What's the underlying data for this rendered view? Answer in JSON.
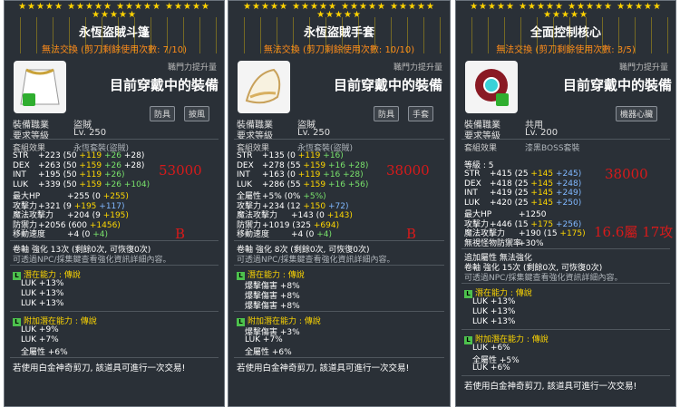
{
  "panels": [
    {
      "stars": "★★★★★ ★★★★★ ★★★★★ ★★★★★ ★★★★★",
      "title": "永恆盜賊斗篷",
      "trade": "無法交換 (剪刀剩餘使用次數: 7/10)",
      "job_boost": "職門力提升量",
      "equipped": "目前穿戴中的裝備",
      "tags": [
        "防具",
        "披風"
      ],
      "req_job_label": "裝備職業",
      "req_job": "盜賊",
      "req_level_label": "要求等級",
      "req_level": "Lv. 250",
      "set_label": "套組效果",
      "set_name": "永恆套裝(盜賊)",
      "stats": [
        {
          "name": "STR",
          "parts": [
            [
              "+223 (50 ",
              ""
            ],
            [
              "+119",
              "y"
            ],
            [
              " +26",
              "g"
            ],
            [
              " +28)",
              ""
            ]
          ]
        },
        {
          "name": "DEX",
          "parts": [
            [
              "+263 (50 ",
              ""
            ],
            [
              "+159",
              "y"
            ],
            [
              " +26",
              "g"
            ],
            [
              " +28)",
              ""
            ]
          ]
        },
        {
          "name": "INT",
          "parts": [
            [
              "+195 (50 ",
              ""
            ],
            [
              "+119",
              "y"
            ],
            [
              " +26)",
              "g"
            ]
          ]
        },
        {
          "name": "LUK",
          "parts": [
            [
              "+339 (50 ",
              ""
            ],
            [
              "+159",
              "y"
            ],
            [
              " +26",
              "g"
            ],
            [
              " +104)",
              "g"
            ]
          ]
        },
        {
          "name": "最大HP",
          "parts": [
            [
              "+255 (0 ",
              ""
            ],
            [
              "+255)",
              "y"
            ]
          ]
        },
        {
          "name": "攻擊力",
          "parts": [
            [
              "+321 (9 ",
              ""
            ],
            [
              "+195",
              "y"
            ],
            [
              " +117)",
              "b"
            ]
          ]
        },
        {
          "name": "魔法攻擊力",
          "parts": [
            [
              "+204 (9 ",
              ""
            ],
            [
              "+195)",
              "y"
            ]
          ]
        },
        {
          "name": "防禦力",
          "parts": [
            [
              "+2056 (600 ",
              ""
            ],
            [
              "+1456)",
              "y"
            ]
          ]
        },
        {
          "name": "移動速度",
          "parts": [
            [
              "+4 (0 ",
              ""
            ],
            [
              "+4)",
              "g"
            ]
          ]
        }
      ],
      "annot_value": "53000",
      "annot_grade": "B",
      "scroll_line": "卷軸 強化 13次 (剩餘0次, 可恢復0次)",
      "hint": "可透過NPC/採集鍵查看強化資訊詳細內容。",
      "potential_label": "潛在能力 : 傳說",
      "potential": [
        "LUK +13%",
        "LUK +13%",
        "LUK +13%"
      ],
      "add_potential_label": "附加潛在能力 : 傳說",
      "add_potential": [
        "LUK +9%",
        "LUK +7%",
        "全屬性 +6%"
      ],
      "footer": "若使用白金神奇剪刀, 該道具可進行一次交易!"
    },
    {
      "stars": "★★★★★ ★★★★★ ★★★★★ ★★★★★ ★★★★★",
      "title": "永恆盜賊手套",
      "trade": "無法交換 (剪刀剩餘使用次數: 10/10)",
      "job_boost": "職門力提升量",
      "equipped": "目前穿戴中的裝備",
      "tags": [
        "防具",
        "手套"
      ],
      "req_job_label": "裝備職業",
      "req_job": "盜賊",
      "req_level_label": "要求等級",
      "req_level": "Lv. 250",
      "set_label": "套組效果",
      "set_name": "永恆套裝(盜賊)",
      "stats": [
        {
          "name": "STR",
          "parts": [
            [
              "+135 (0 ",
              ""
            ],
            [
              "+119",
              "y"
            ],
            [
              " +16)",
              "g"
            ]
          ]
        },
        {
          "name": "DEX",
          "parts": [
            [
              "+278 (55 ",
              ""
            ],
            [
              "+159",
              "y"
            ],
            [
              " +16",
              "g"
            ],
            [
              " +28)",
              "g"
            ]
          ]
        },
        {
          "name": "INT",
          "parts": [
            [
              "+163 (0 ",
              ""
            ],
            [
              "+119",
              "y"
            ],
            [
              " +16",
              "g"
            ],
            [
              " +28)",
              "g"
            ]
          ]
        },
        {
          "name": "LUK",
          "parts": [
            [
              "+286 (55 ",
              ""
            ],
            [
              "+159",
              "y"
            ],
            [
              " +16",
              "g"
            ],
            [
              " +56)",
              "g"
            ]
          ]
        },
        {
          "name": "全屬性",
          "parts": [
            [
              "+5% (0% ",
              ""
            ],
            [
              "+5%)",
              "g"
            ]
          ]
        },
        {
          "name": "攻擊力",
          "parts": [
            [
              "+234 (12 ",
              ""
            ],
            [
              "+150",
              "y"
            ],
            [
              " +72)",
              "b"
            ]
          ]
        },
        {
          "name": "魔法攻擊力",
          "parts": [
            [
              "+143 (0 ",
              ""
            ],
            [
              "+143)",
              "y"
            ]
          ]
        },
        {
          "name": "防禦力",
          "parts": [
            [
              "+1019 (325 ",
              ""
            ],
            [
              "+694)",
              "y"
            ]
          ]
        },
        {
          "name": "移動速度",
          "parts": [
            [
              "+4 (0 ",
              ""
            ],
            [
              "+4)",
              "g"
            ]
          ]
        }
      ],
      "annot_value": "38000",
      "annot_grade": "B",
      "scroll_line": "卷軸 強化 8次 (剩餘0次, 可恢復0次)",
      "hint": "可透過NPC/採集鍵查看強化資訊詳細內容。",
      "potential_label": "潛在能力 : 傳說",
      "potential": [
        "爆擊傷害 +8%",
        "爆擊傷害 +8%",
        "爆擊傷害 +8%"
      ],
      "add_potential_label": "附加潛在能力 : 傳說",
      "add_potential": [
        "爆擊傷害 +3%",
        "LUK +7%",
        "全屬性 +6%"
      ],
      "footer": "若使用白金神奇剪刀, 該道具可進行一次交易!"
    },
    {
      "stars": "★★★★★ ★★★★★ ★★★★★ ★★★★★ ★★★★★",
      "title": "全面控制核心",
      "trade": "無法交換 (剪刀剩餘使用次數: 3/5)",
      "job_boost": "職門力提升量",
      "equipped": "目前穿戴中的裝備",
      "tags": [
        "機器心臟"
      ],
      "req_job_label": "裝備職業",
      "req_job": "共用",
      "req_level_label": "要求等級",
      "req_level": "Lv. 200",
      "set_label": "套組效果",
      "set_name": "漆黑BOSS套裝",
      "grade_line": "等級 : 5",
      "stats": [
        {
          "name": "STR",
          "parts": [
            [
              "+415 (25 ",
              ""
            ],
            [
              "+145",
              "y"
            ],
            [
              " +245)",
              "b"
            ]
          ]
        },
        {
          "name": "DEX",
          "parts": [
            [
              "+418 (25 ",
              ""
            ],
            [
              "+145",
              "y"
            ],
            [
              " +248)",
              "b"
            ]
          ]
        },
        {
          "name": "INT",
          "parts": [
            [
              "+419 (25 ",
              ""
            ],
            [
              "+145",
              "y"
            ],
            [
              " +249)",
              "b"
            ]
          ]
        },
        {
          "name": "LUK",
          "parts": [
            [
              "+420 (25 ",
              ""
            ],
            [
              "+145",
              "y"
            ],
            [
              " +250)",
              "b"
            ]
          ]
        },
        {
          "name": "最大HP",
          "parts": [
            [
              "+1250",
              ""
            ]
          ]
        },
        {
          "name": "攻擊力",
          "parts": [
            [
              "+446 (15 ",
              ""
            ],
            [
              "+175",
              "y"
            ],
            [
              " +256)",
              "b"
            ]
          ]
        },
        {
          "name": "魔法攻擊力",
          "parts": [
            [
              "+190 (15 ",
              ""
            ],
            [
              "+175)",
              "y"
            ]
          ]
        },
        {
          "name": "無視怪物防禦率",
          "parts": [
            [
              "+30%",
              ""
            ]
          ]
        }
      ],
      "annot_value": "38000",
      "annot_grade": "16.6屬 17攻",
      "extra_line": "追加屬性 無法強化",
      "scroll_line": "卷軸 強化 15次 (剩餘0次, 可恢復0次)",
      "hint": "可透過NPC/採集鍵查看強化資訊詳細內容。",
      "potential_label": "潛在能力 : 傳說",
      "potential": [
        "LUK +13%",
        "LUK +13%",
        "LUK +13%"
      ],
      "add_potential_label": "附加潛在能力 : 傳說",
      "add_potential": [
        "LUK +6%",
        "全屬性 +5%",
        "LUK +6%"
      ],
      "footer": "若使用白金神奇剪刀, 該道具可進行一次交易!"
    }
  ]
}
